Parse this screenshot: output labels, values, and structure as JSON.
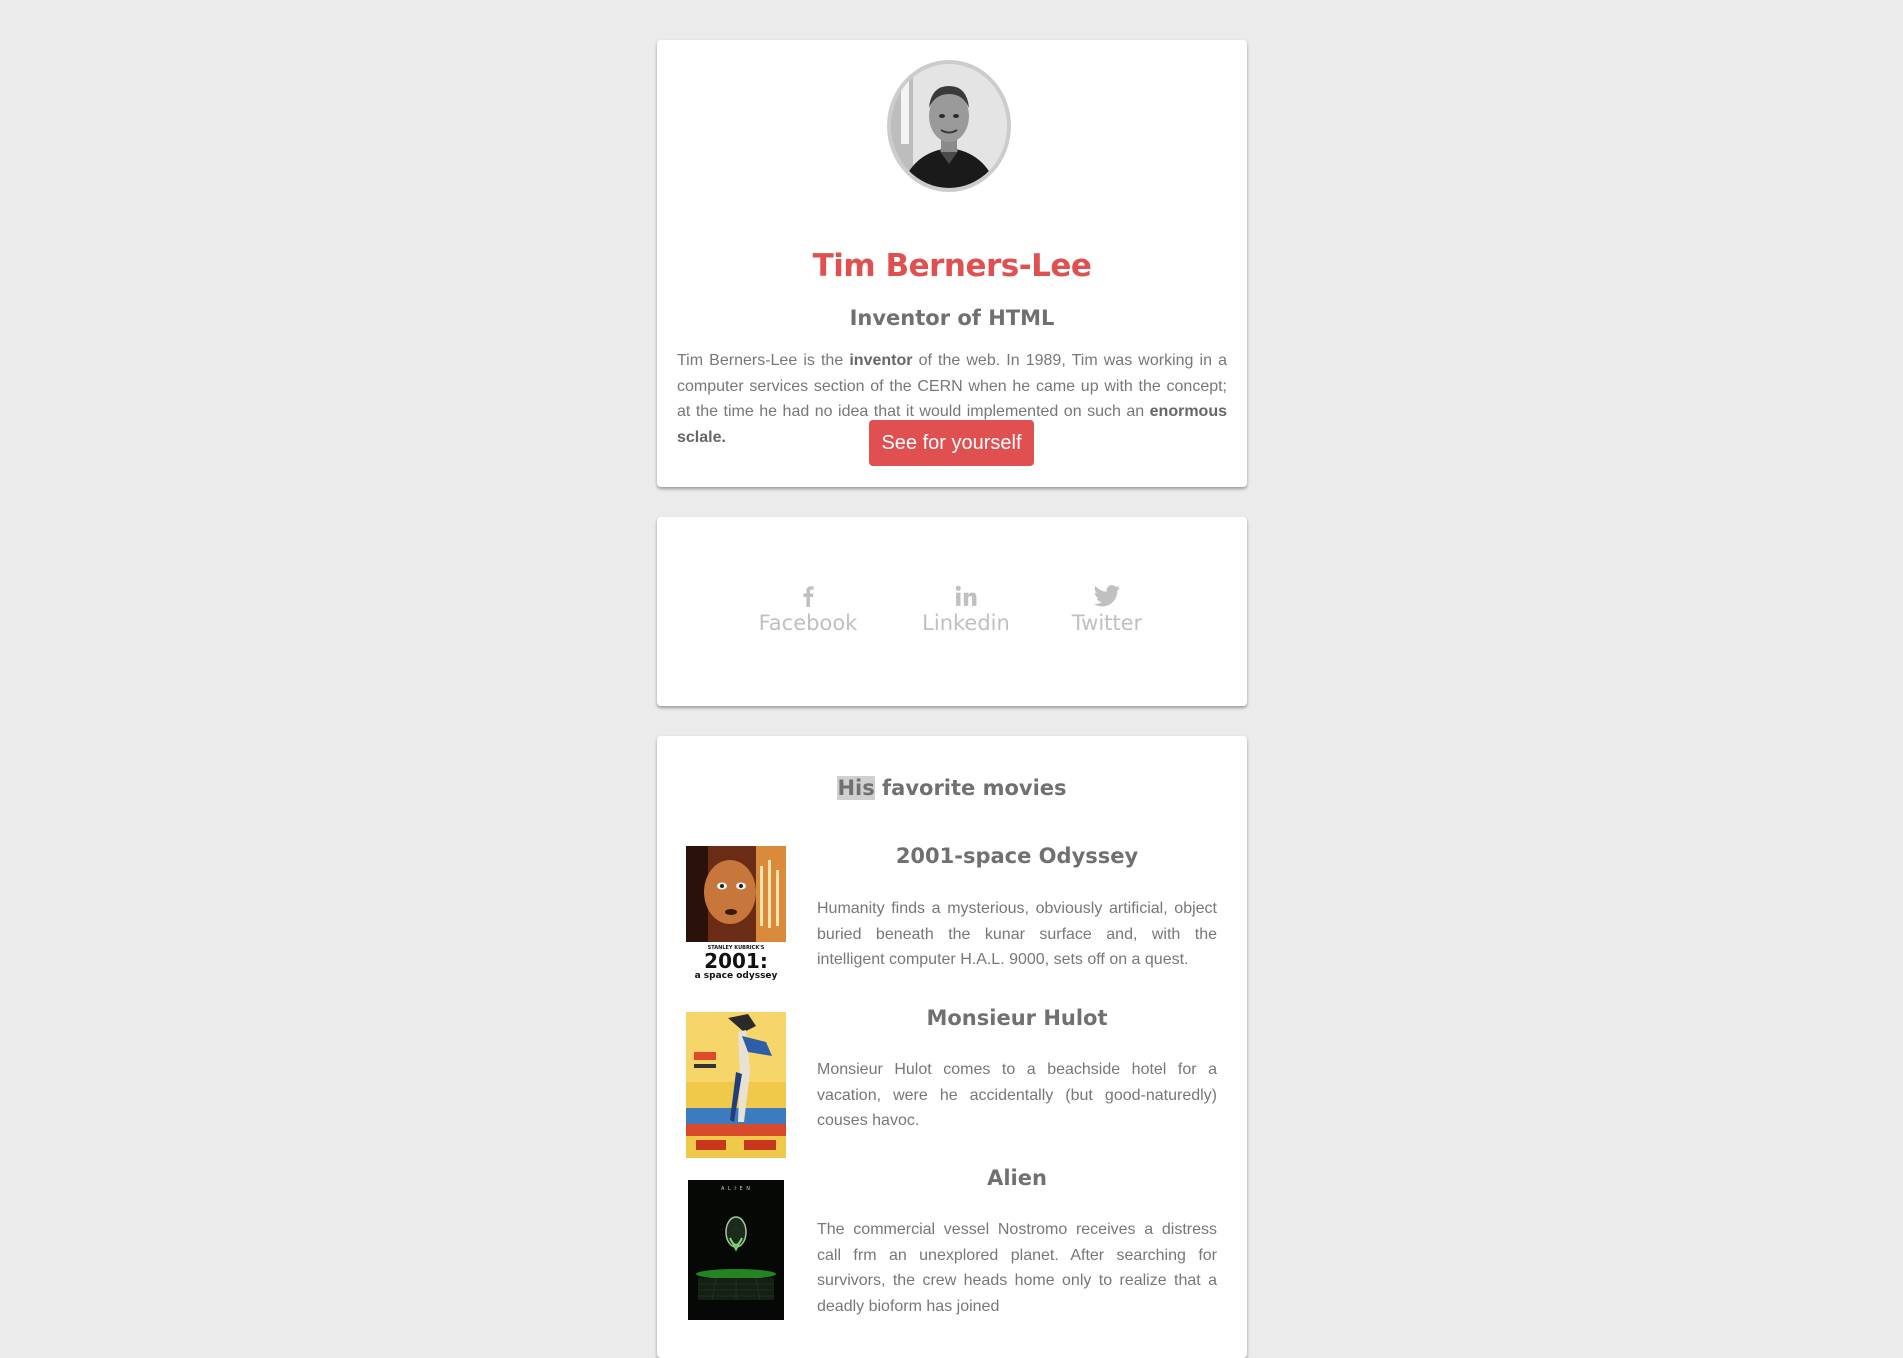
{
  "profile": {
    "name": "Tim Berners-Lee",
    "role": "Inventor of HTML",
    "bio": {
      "part1": "Tim Berners-Lee is the ",
      "bold1": "inventor",
      "part2": " of the web. In 1989, Tim was working in a computer services section of the CERN when he came up with the concept; at the time he had no idea that it would implemented on such an ",
      "bold2": "enormous sclale."
    },
    "button_label": "See for yourself"
  },
  "social": {
    "items": [
      {
        "label": "Facebook",
        "icon": "facebook-icon"
      },
      {
        "label": "Linkedin",
        "icon": "linkedin-icon"
      },
      {
        "label": "Twitter",
        "icon": "twitter-icon"
      }
    ]
  },
  "movies": {
    "heading_highlight": "His",
    "heading_rest": " favorite movies",
    "items": [
      {
        "title": "2001-space Odyssey",
        "description": "Humanity finds a mysterious, obviously artificial, object buried beneath the kunar surface and, with the intelligent computer H.A.L. 9000, sets off on a quest.",
        "poster_caption_small": "STANLEY KUBRICK'S",
        "poster_caption_big": "2001:",
        "poster_caption_sub": "a space odyssey"
      },
      {
        "title": "Monsieur Hulot",
        "description": "Monsieur Hulot comes to a beachside hotel for a vacation, were he accidentally (but good-naturedly) couses havoc."
      },
      {
        "title": "Alien",
        "description": "The commercial vessel Nostromo receives a distress call frm an unexplored planet. After searching for survivors, the crew heads home only to realize that a deadly bioform has joined",
        "poster_caption": "A L I E N"
      }
    ]
  },
  "colors": {
    "accent": "#e05050",
    "text": "#777777",
    "heading": "#707070",
    "background": "#ebebeb"
  }
}
